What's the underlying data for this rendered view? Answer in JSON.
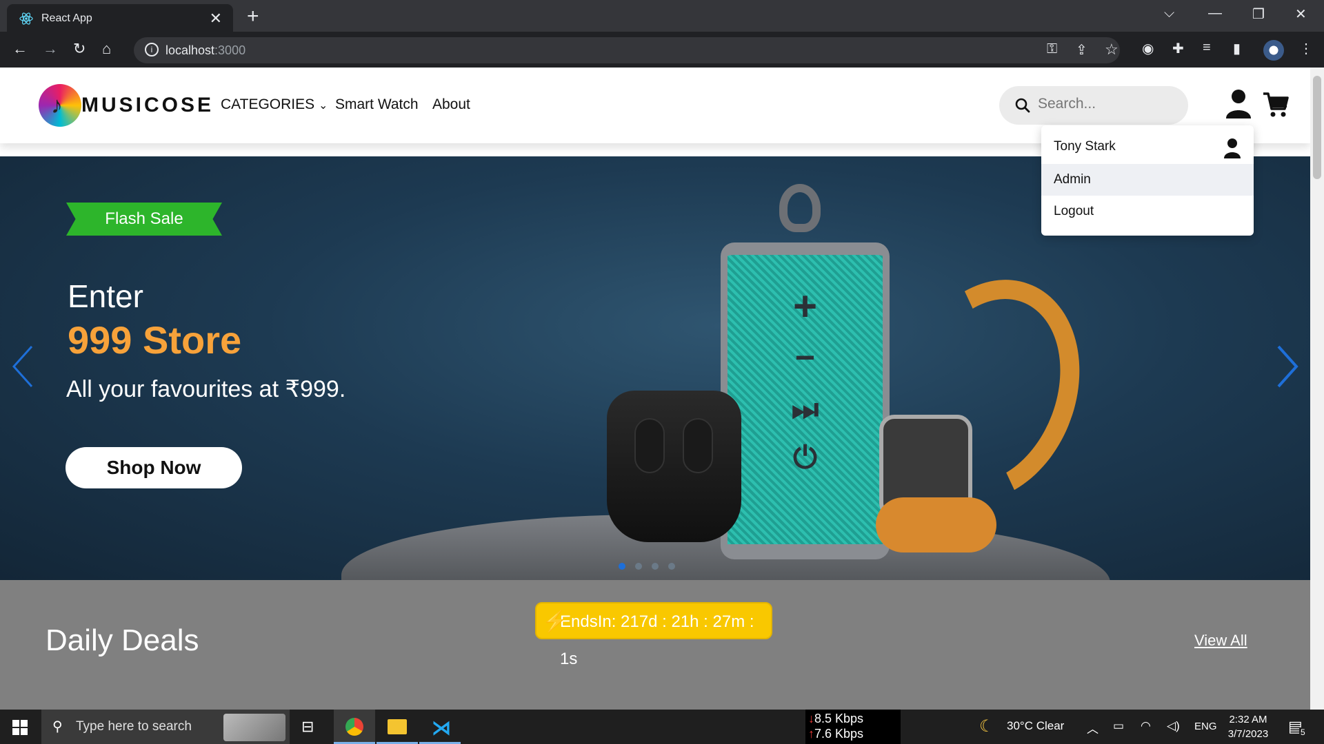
{
  "browser": {
    "tab_title": "React App",
    "url_host": "localhost",
    "url_port": ":3000"
  },
  "header": {
    "logo_text": "MUSICOSE",
    "nav": {
      "categories": "CATEGORIES",
      "smart_watch": "Smart Watch",
      "about": "About"
    },
    "search_placeholder": "Search..."
  },
  "user_menu": {
    "name": "Tony Stark",
    "admin": "Admin",
    "logout": "Logout"
  },
  "hero": {
    "badge": "Flash Sale",
    "line1": "Enter",
    "line2": "999 Store",
    "subtitle": "All your favourites at ₹999.",
    "cta": "Shop Now",
    "slide_count": 4,
    "active_slide": 1
  },
  "deals": {
    "title": "Daily Deals",
    "view_all": "View All",
    "countdown": "EndsIn: 217d : 21h : 27m : 1s"
  },
  "taskbar": {
    "search_placeholder": "Type here to search",
    "down_speed": "8.5 Kbps",
    "up_speed": "7.6 Kbps",
    "weather": "30°C  Clear",
    "lang": "ENG",
    "time": "2:32 AM",
    "date": "3/7/2023",
    "notifications": "5"
  },
  "colors": {
    "accent_orange": "#f7a23a",
    "flash_green": "#2db52b",
    "countdown_yellow": "#f9c800",
    "arrow_blue": "#1e6fd9"
  }
}
